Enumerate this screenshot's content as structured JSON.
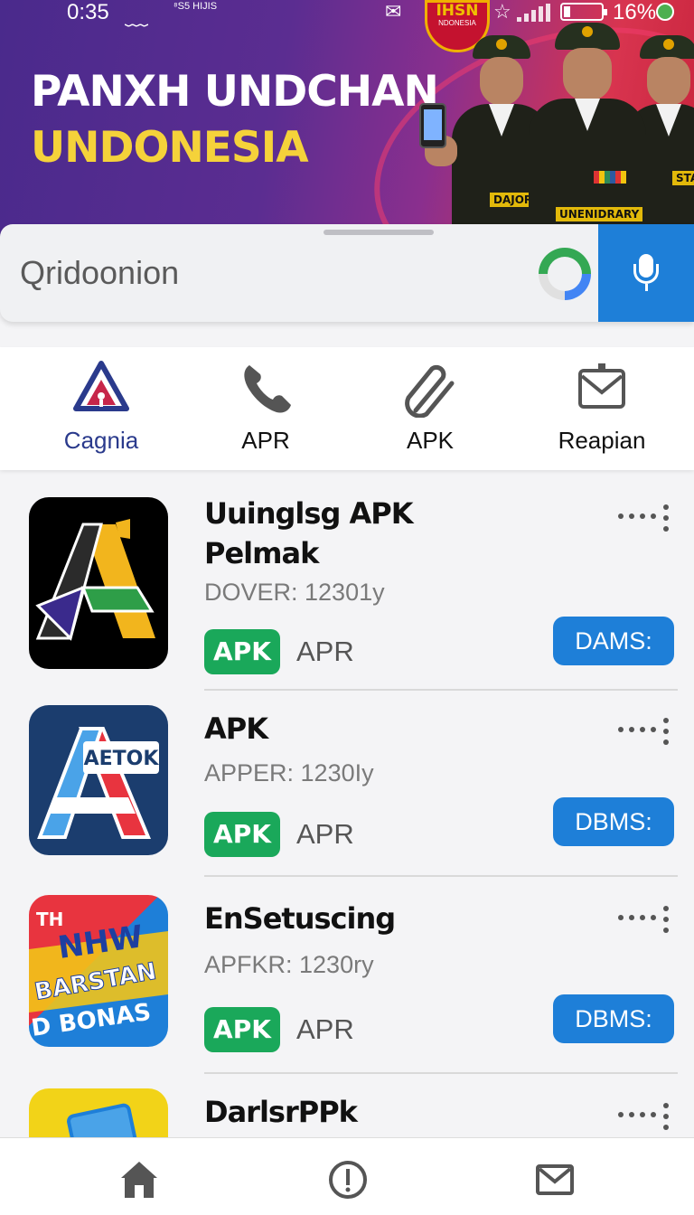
{
  "status_bar": {
    "time": "0:35",
    "sub_label": "⁸S5 HIJIS",
    "battery": "16%"
  },
  "banner": {
    "emblem_line1": "IHSN",
    "emblem_line2": "NDONESIA",
    "title_line1": "PANXH UNDCHAN",
    "title_line2": "UNDONESIA",
    "officer_tags": [
      "DAJORI",
      "UNENIDRARY",
      "STAVEL"
    ],
    "title_colors": {
      "line1": "#ffffff",
      "line2": "#f5d23a"
    }
  },
  "search": {
    "placeholder": "Qridoonion"
  },
  "categories": [
    {
      "label": "Cagnia",
      "icon": "alert-triangle-icon",
      "active": true
    },
    {
      "label": "APR",
      "icon": "phone-icon",
      "active": false
    },
    {
      "label": "APK",
      "icon": "paperclip-icon",
      "active": false
    },
    {
      "label": "Reapian",
      "icon": "mail-icon",
      "active": false
    }
  ],
  "apps": [
    {
      "name_line1": "Uuinglsg APK",
      "name_line2": "Pelmak",
      "version": "DOVER: 12301y",
      "badge": "APK",
      "tag": "APR",
      "action": "DAMS:",
      "icon_text": ""
    },
    {
      "name_line1": "APK",
      "name_line2": "",
      "version": "APPER: 1230Iy",
      "badge": "APK",
      "tag": "APR",
      "action": "DBMS:",
      "icon_text": "AETOK"
    },
    {
      "name_line1": "EnSetuscing",
      "name_line2": "",
      "version": "APFKR: 1230ry",
      "badge": "APK",
      "tag": "APR",
      "action": "DBMS:",
      "icon_text": [
        "TH",
        "NHW",
        "BARSTAN",
        "D BONAS"
      ]
    },
    {
      "name_line1": "DarlsrPPk",
      "name_line2": "",
      "version": "",
      "badge": "",
      "tag": "",
      "action": "",
      "icon_text": ""
    }
  ],
  "bottom_nav": [
    {
      "icon": "home-icon",
      "label": ""
    },
    {
      "icon": "info-icon",
      "label": ""
    },
    {
      "icon": "mail-icon",
      "label": ""
    }
  ],
  "colors": {
    "accent_blue": "#1e7fd8",
    "badge_green": "#1aa85a",
    "active_category": "#2a3a8c"
  }
}
